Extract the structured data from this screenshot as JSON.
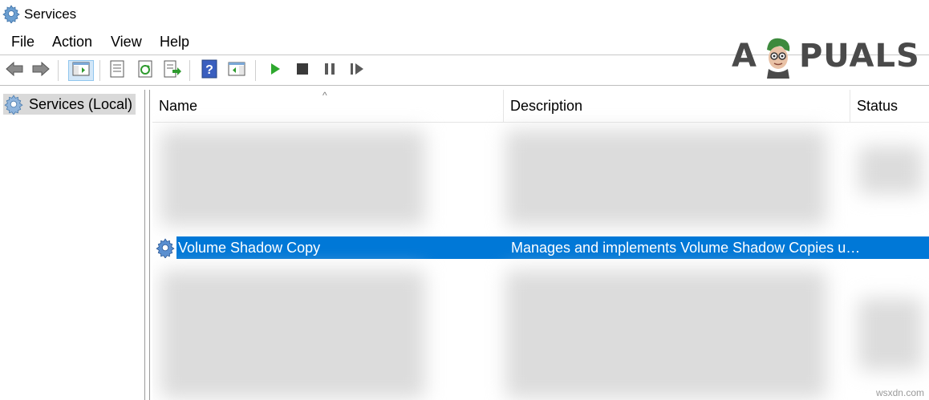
{
  "window": {
    "title": "Services",
    "icon": "gear-icon"
  },
  "menu": {
    "file": "File",
    "action": "Action",
    "view": "View",
    "help": "Help"
  },
  "toolbar": {
    "icons": [
      "back-arrow-icon",
      "forward-arrow-icon",
      "show-hide-console-tree-icon",
      "properties-icon",
      "refresh-icon",
      "export-list-icon",
      "help-icon",
      "show-hide-action-pane-icon",
      "start-service-icon",
      "stop-service-icon",
      "pause-service-icon",
      "resume-service-icon"
    ],
    "colors": {
      "start": "#2ea82e",
      "stop": "#3a3a3a",
      "pause": "#5a5a5a"
    }
  },
  "logo": {
    "text_left": "A",
    "text_right": "PUALS"
  },
  "tree": {
    "item": "Services (Local)"
  },
  "columns": {
    "name": "Name",
    "description": "Description",
    "status": "Status"
  },
  "selected_row": {
    "name": "Volume Shadow Copy",
    "description": "Manages and implements Volume Shadow Copies u…",
    "status": ""
  },
  "colors": {
    "selection": "#0078d7",
    "tree_selection": "#d9d9d9"
  },
  "watermark": "wsxdn.com"
}
